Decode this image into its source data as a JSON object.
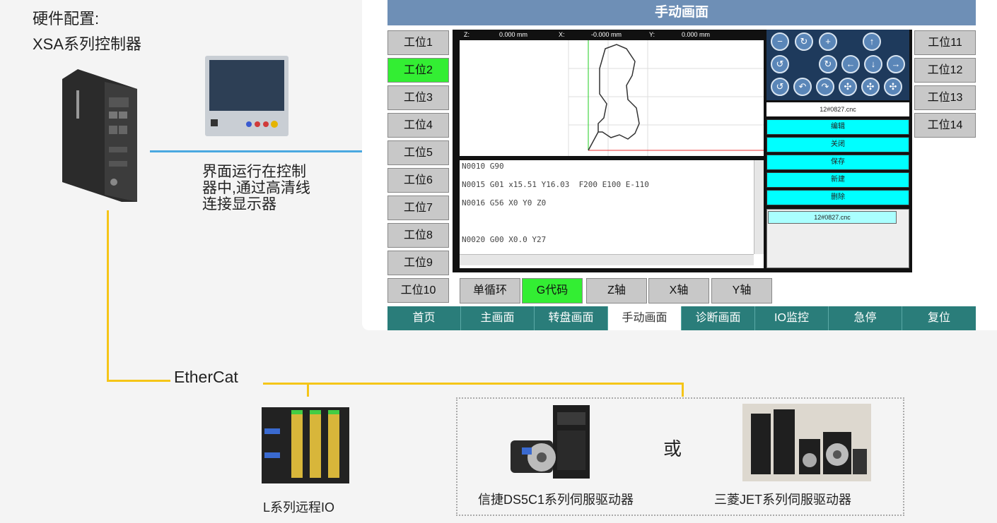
{
  "labels": {
    "hardware_title": "硬件配置:",
    "controller_name": "XSA系列控制器",
    "ui_note": "界面运行在控制器中,通过高清线连接显示器",
    "bus": "EtherCat",
    "io_caption": "L系列远程IO",
    "servo1_caption": "信捷DS5C1系列伺服驱动器",
    "or": "或",
    "servo2_caption": "三菱JET系列伺服驱动器"
  },
  "hmi": {
    "title": "手动画面",
    "left_stations": [
      "工位1",
      "工位2",
      "工位3",
      "工位4",
      "工位5",
      "工位6",
      "工位7",
      "工位8",
      "工位9",
      "工位10"
    ],
    "right_stations": [
      "工位11",
      "工位12",
      "工位13",
      "工位14"
    ],
    "selected_station": "工位2",
    "coords": {
      "z_label": "Z:",
      "z_value": "0.000 mm",
      "x_label": "X:",
      "x_value": "-0.000 mm",
      "y_label": "Y:",
      "y_value": "0.000 mm"
    },
    "gcode": [
      "N0010 G90",
      "N0015 G01 x15.51 Y16.03  F200 E100 E-110",
      "N0016 G56 X0 Y0 Z0",
      "N0020 G00 X0.0 Y27"
    ],
    "filename": "12#0827.cnc",
    "file_actions": [
      "编辑",
      "关闭",
      "保存",
      "新建",
      "删除"
    ],
    "list_file": "12#0827.cnc",
    "mode_tabs": [
      "单循环",
      "G代码",
      "Z轴",
      "X轴",
      "Y轴"
    ],
    "active_mode": "G代码",
    "nav_tabs": [
      "首页",
      "主画面",
      "转盘画面",
      "手动画面",
      "诊断画面",
      "IO监控",
      "急停",
      "复位"
    ],
    "active_nav": "手动画面",
    "colors": {
      "title": "#6e8fb6",
      "nav": "#2a7d7a",
      "selected": "#33ee33",
      "action": "#00ffff",
      "connector_blue": "#4aa8e0",
      "connector_yellow": "#f5c518"
    }
  }
}
